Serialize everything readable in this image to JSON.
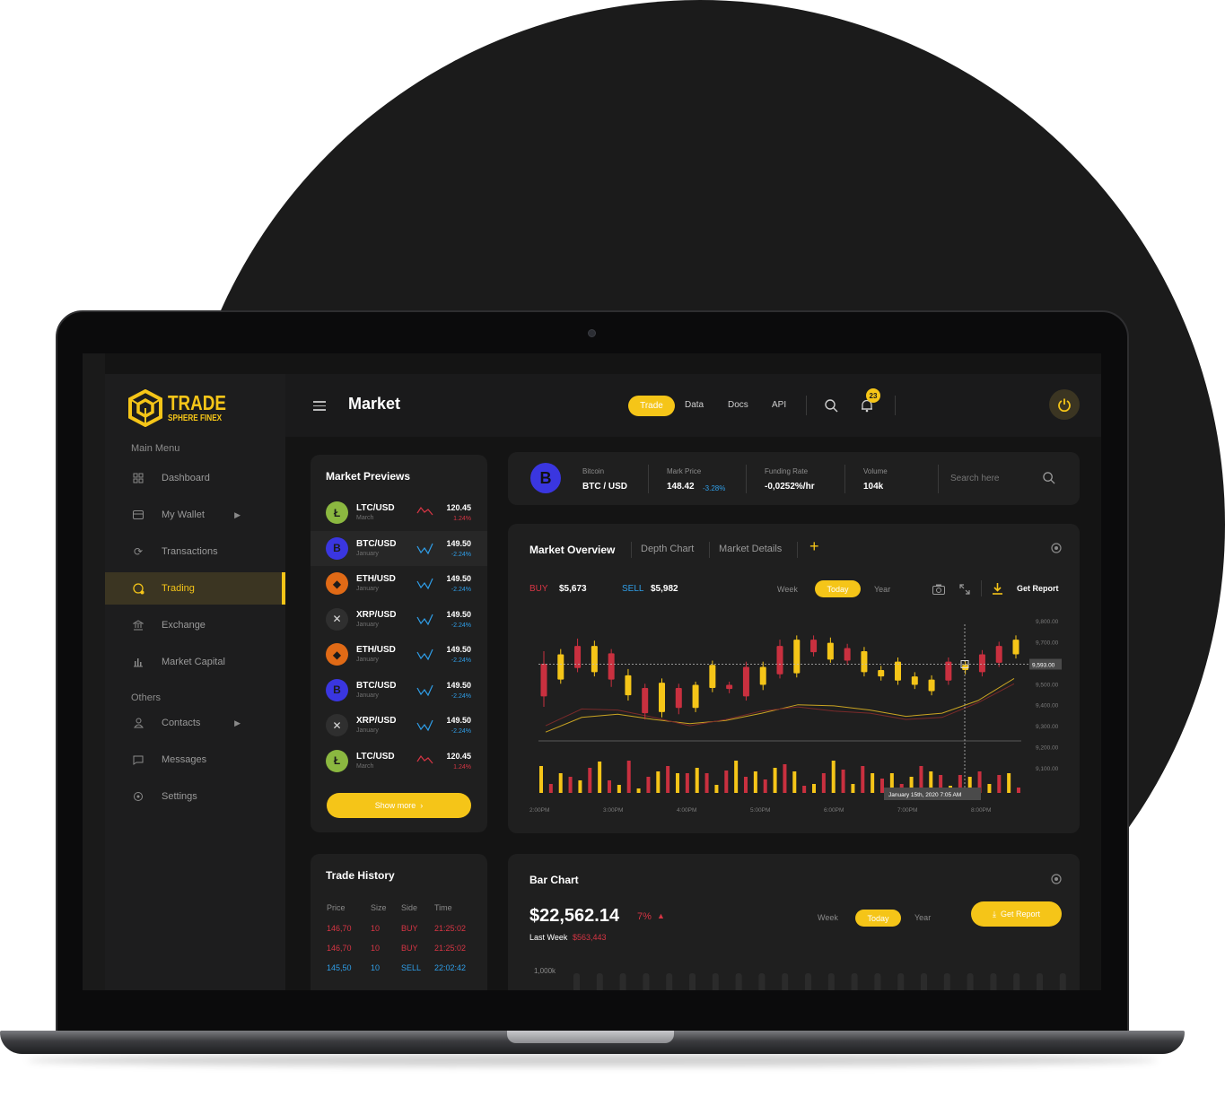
{
  "brand": {
    "name_top": "TRADE",
    "name_bottom": "SPHERE FINEX",
    "color": "#f5c518"
  },
  "sidebar": {
    "main_menu_label": "Main Menu",
    "others_label": "Others",
    "items": [
      {
        "label": "Dashboard",
        "icon": "grid-icon"
      },
      {
        "label": "My Wallet",
        "icon": "wallet-icon"
      },
      {
        "label": "Transactions",
        "icon": "refresh-icon"
      },
      {
        "label": "Trading",
        "icon": "trading-icon"
      },
      {
        "label": "Exchange",
        "icon": "bank-icon"
      },
      {
        "label": "Market Capital",
        "icon": "bar-chart-icon"
      }
    ],
    "other_items": [
      {
        "label": "Contacts",
        "icon": "user-icon"
      },
      {
        "label": "Messages",
        "icon": "message-icon"
      },
      {
        "label": "Settings",
        "icon": "gear-icon"
      }
    ]
  },
  "header": {
    "title": "Market",
    "nav": [
      "Trade",
      "Data",
      "Docs",
      "API"
    ],
    "notification_count": "23"
  },
  "market_previews": {
    "title": "Market Previews",
    "rows": [
      {
        "pair": "LTC/USD",
        "sub": "March",
        "price": "120.45",
        "change": "1.24%",
        "trend": "down",
        "coin_color": "#8bb840",
        "glyph": "Ł"
      },
      {
        "pair": "BTC/USD",
        "sub": "January",
        "price": "149.50",
        "change": "-2.24%",
        "trend": "up",
        "coin_color": "#3a36e0",
        "glyph": "B"
      },
      {
        "pair": "ETH/USD",
        "sub": "January",
        "price": "149.50",
        "change": "-2.24%",
        "trend": "up",
        "coin_color": "#e06a16",
        "glyph": "◆"
      },
      {
        "pair": "XRP/USD",
        "sub": "January",
        "price": "149.50",
        "change": "-2.24%",
        "trend": "up",
        "coin_color": "#2f2f2f",
        "glyph": "✕"
      },
      {
        "pair": "ETH/USD",
        "sub": "January",
        "price": "149.50",
        "change": "-2.24%",
        "trend": "up",
        "coin_color": "#e06a16",
        "glyph": "◆"
      },
      {
        "pair": "BTC/USD",
        "sub": "January",
        "price": "149.50",
        "change": "-2.24%",
        "trend": "up",
        "coin_color": "#3a36e0",
        "glyph": "B"
      },
      {
        "pair": "XRP/USD",
        "sub": "January",
        "price": "149.50",
        "change": "-2.24%",
        "trend": "up",
        "coin_color": "#2f2f2f",
        "glyph": "✕"
      },
      {
        "pair": "LTC/USD",
        "sub": "March",
        "price": "120.45",
        "change": "1.24%",
        "trend": "down",
        "coin_color": "#8bb840",
        "glyph": "Ł"
      }
    ],
    "show_more": "Show more"
  },
  "trade_history": {
    "title": "Trade History",
    "columns": [
      "Price",
      "Size",
      "Side",
      "Time"
    ],
    "rows": [
      {
        "price": "146,70",
        "size": "10",
        "side": "BUY",
        "time": "21:25:02"
      },
      {
        "price": "146,70",
        "size": "10",
        "side": "BUY",
        "time": "21:25:02"
      },
      {
        "price": "145,50",
        "size": "10",
        "side": "SELL",
        "time": "22:02:42"
      }
    ]
  },
  "ticker": {
    "coin_name": "Bitcoin",
    "pair": "BTC / USD",
    "mark_price_label": "Mark Price",
    "mark_price": "148.42",
    "mark_change": "-3.28%",
    "funding_label": "Funding Rate",
    "funding": "-0,0252%/hr",
    "volume_label": "Volume",
    "volume": "104k",
    "search_placeholder": "Search here"
  },
  "overview": {
    "tabs": [
      "Market Overview",
      "Depth Chart",
      "Market Details"
    ],
    "buy_label": "BUY",
    "buy_value": "$5,673",
    "sell_label": "SELL",
    "sell_value": "$5,982",
    "range": [
      "Week",
      "Today",
      "Year"
    ],
    "report": "Get Report",
    "price_tag": "9,593.00",
    "tooltip": "January 15th, 2020 7:05 AM"
  },
  "bar_card": {
    "title": "Bar Chart",
    "amount": "$22,562.14",
    "pct": "7%",
    "last_week_label": "Last Week",
    "last_week_value": "$563,443",
    "range": [
      "Week",
      "Today",
      "Year"
    ],
    "report": "Get Report",
    "y_top": "1,000k"
  },
  "colors": {
    "accent": "#f5c518",
    "up": "#2f9ee8",
    "down": "#d63544",
    "bg": "#141414",
    "card": "#1f1f1f"
  },
  "chart_data": {
    "type": "candlestick",
    "x_ticks": [
      "2:00PM",
      "3:00PM",
      "4:00PM",
      "5:00PM",
      "6:00PM",
      "7:00PM",
      "8:00PM"
    ],
    "y_ticks": [
      "9,800.00",
      "9,700.00",
      "9,600.00",
      "9,500.00",
      "9,400.00",
      "9,300.00",
      "9,200.00",
      "9,100.00"
    ],
    "ylim": [
      9100,
      9800
    ],
    "candles": [
      {
        "o": 9595,
        "c": 9440,
        "h": 9655,
        "l": 9390,
        "color": "red"
      },
      {
        "o": 9520,
        "c": 9640,
        "h": 9665,
        "l": 9500,
        "color": "yellow"
      },
      {
        "o": 9680,
        "c": 9575,
        "h": 9715,
        "l": 9555,
        "color": "red"
      },
      {
        "o": 9555,
        "c": 9680,
        "h": 9705,
        "l": 9535,
        "color": "yellow"
      },
      {
        "o": 9645,
        "c": 9520,
        "h": 9665,
        "l": 9485,
        "color": "red"
      },
      {
        "o": 9540,
        "c": 9445,
        "h": 9570,
        "l": 9420,
        "color": "yellow"
      },
      {
        "o": 9480,
        "c": 9360,
        "h": 9500,
        "l": 9330,
        "color": "red"
      },
      {
        "o": 9505,
        "c": 9365,
        "h": 9525,
        "l": 9340,
        "color": "yellow"
      },
      {
        "o": 9480,
        "c": 9385,
        "h": 9500,
        "l": 9355,
        "color": "red"
      },
      {
        "o": 9495,
        "c": 9385,
        "h": 9510,
        "l": 9365,
        "color": "yellow"
      },
      {
        "o": 9590,
        "c": 9480,
        "h": 9610,
        "l": 9460,
        "color": "yellow"
      },
      {
        "o": 9495,
        "c": 9475,
        "h": 9510,
        "l": 9455,
        "color": "red"
      },
      {
        "o": 9440,
        "c": 9580,
        "h": 9605,
        "l": 9420,
        "color": "red"
      },
      {
        "o": 9495,
        "c": 9580,
        "h": 9605,
        "l": 9470,
        "color": "yellow"
      },
      {
        "o": 9680,
        "c": 9545,
        "h": 9710,
        "l": 9525,
        "color": "red"
      },
      {
        "o": 9710,
        "c": 9550,
        "h": 9730,
        "l": 9530,
        "color": "yellow"
      },
      {
        "o": 9710,
        "c": 9650,
        "h": 9730,
        "l": 9630,
        "color": "red"
      },
      {
        "o": 9615,
        "c": 9695,
        "h": 9720,
        "l": 9600,
        "color": "yellow"
      },
      {
        "o": 9670,
        "c": 9610,
        "h": 9690,
        "l": 9590,
        "color": "red"
      },
      {
        "o": 9655,
        "c": 9555,
        "h": 9675,
        "l": 9535,
        "color": "yellow"
      },
      {
        "o": 9565,
        "c": 9535,
        "h": 9585,
        "l": 9515,
        "color": "yellow"
      },
      {
        "o": 9605,
        "c": 9515,
        "h": 9625,
        "l": 9495,
        "color": "yellow"
      },
      {
        "o": 9535,
        "c": 9495,
        "h": 9555,
        "l": 9475,
        "color": "yellow"
      },
      {
        "o": 9520,
        "c": 9465,
        "h": 9540,
        "l": 9445,
        "color": "yellow"
      },
      {
        "o": 9515,
        "c": 9605,
        "h": 9625,
        "l": 9495,
        "color": "red"
      },
      {
        "o": 9565,
        "c": 9590,
        "h": 9610,
        "l": 9545,
        "color": "yellow"
      },
      {
        "o": 9640,
        "c": 9555,
        "h": 9660,
        "l": 9535,
        "color": "red"
      },
      {
        "o": 9600,
        "c": 9680,
        "h": 9700,
        "l": 9580,
        "color": "red"
      },
      {
        "o": 9640,
        "c": 9710,
        "h": 9730,
        "l": 9620,
        "color": "yellow"
      }
    ],
    "volume": [
      30,
      10,
      22,
      18,
      14,
      28,
      35,
      14,
      9,
      36,
      5,
      18,
      24,
      30,
      22,
      22,
      28,
      22,
      9,
      25,
      36,
      18,
      24,
      15,
      28,
      32,
      24,
      8,
      10,
      22,
      36,
      26,
      10,
      30,
      22,
      16,
      22,
      10,
      18,
      30,
      24,
      20,
      8,
      20,
      18,
      24,
      10,
      20,
      22,
      6
    ],
    "ma_lines": [
      {
        "name": "",
        "color": "#c9a422",
        "values": [
          9270,
          9340,
          9355,
          9330,
          9310,
          9325,
          9360,
          9400,
          9395,
          9375,
          9345,
          9360,
          9420,
          9525
        ]
      },
      {
        "name": "",
        "color": "#7a2a2a",
        "values": [
          9300,
          9380,
          9375,
          9340,
          9300,
          9330,
          9370,
          9390,
          9370,
          9360,
          9330,
          9340,
          9410,
          9500
        ]
      }
    ]
  },
  "bar_chart_data": {
    "type": "bar",
    "values": [
      0.9,
      0.9,
      0.9,
      0.9,
      0.9,
      0.9,
      0.9,
      0.9,
      0.9,
      0.9,
      0.9,
      0.9,
      0.9,
      0.9,
      0.9,
      0.9,
      0.9,
      0.9,
      0.9,
      0.9,
      0.9,
      0.9
    ]
  }
}
